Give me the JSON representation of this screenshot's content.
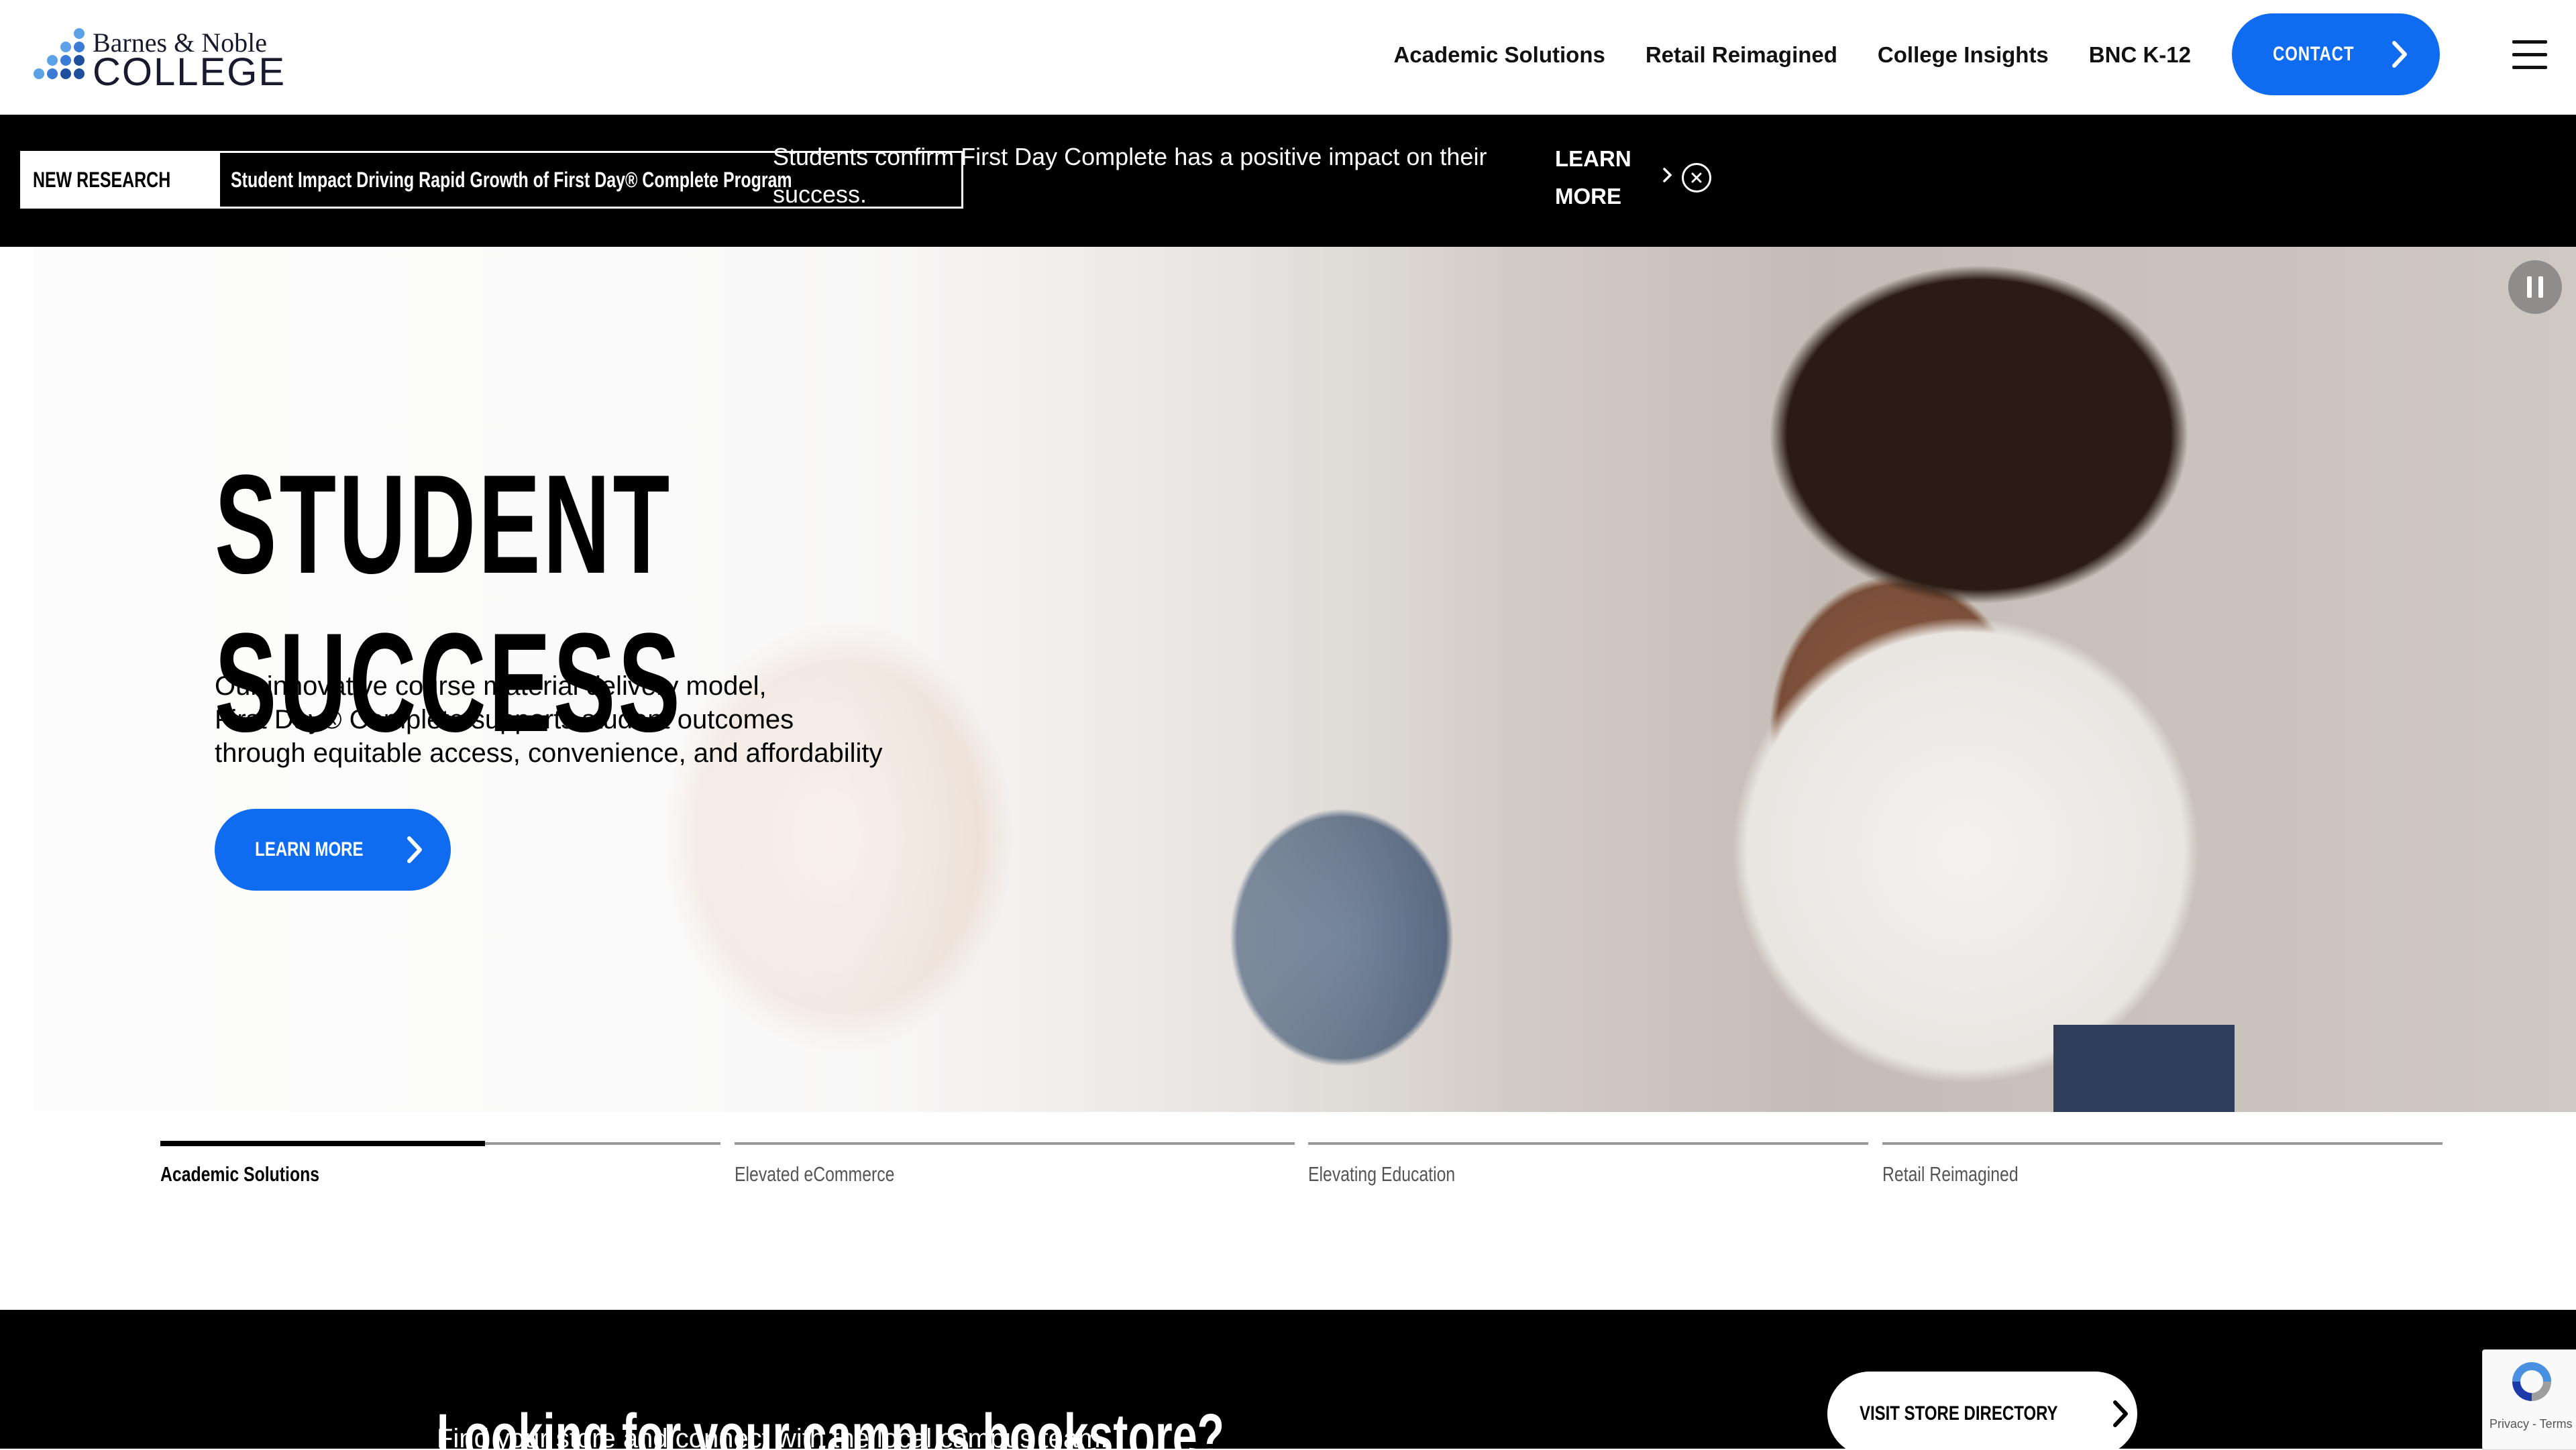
{
  "header": {
    "brand_line1": "Barnes & Noble",
    "brand_line2": "COLLEGE",
    "nav": [
      {
        "label": "Academic Solutions"
      },
      {
        "label": "Retail Reimagined"
      },
      {
        "label": "College Insights"
      },
      {
        "label": "BNC K-12"
      }
    ],
    "contact_label": "CONTACT",
    "menu_icon": "hamburger-menu-icon"
  },
  "announcement": {
    "tag_label": "NEW RESEARCH",
    "headline": "Student Impact Driving Rapid Growth of First Day® Complete Program",
    "description": "Students confirm First Day Complete has a positive impact on their success.",
    "learn_more_line1": "LEARN",
    "learn_more_line2": "MORE"
  },
  "hero": {
    "title_line1": "STUDENT",
    "title_line2": "SUCCESS",
    "body_line1": "Our innovative course material delivery model,",
    "body_line2": "First Day® Complete supports student outcomes",
    "body_line3": "through equitable access, convenience, and affordability",
    "cta_label": "LEARN MORE"
  },
  "slides": {
    "tabs": [
      {
        "label": "Academic Solutions",
        "progress": 0.58,
        "active": true
      },
      {
        "label": "Elevated eCommerce",
        "progress": 0,
        "active": false
      },
      {
        "label": "Elevating Education",
        "progress": 0,
        "active": false
      },
      {
        "label": "Retail Reimagined",
        "progress": 0,
        "active": false
      }
    ]
  },
  "bookstore": {
    "heading": "Looking for your campus bookstore?",
    "subtext": "Find your store and connect with the local campus team.",
    "button_label": "VISIT STORE DIRECTORY"
  },
  "recaptcha": {
    "text": "Privacy - Terms"
  },
  "colors": {
    "accent": "#0f6cf0",
    "logo_dark": "#1f4e9c",
    "logo_light": "#5ba3e6",
    "band": "#000000"
  }
}
